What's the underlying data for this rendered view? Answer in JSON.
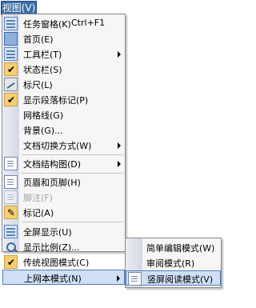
{
  "menubar": {
    "title": "视图(V)"
  },
  "menu": {
    "items": [
      {
        "label": "任务窗格(K)",
        "shortcut": "Ctrl+F1"
      },
      {
        "label": "首页(E)"
      },
      {
        "label": "工具栏(T)"
      },
      {
        "label": "状态栏(S)"
      },
      {
        "label": "标尺(L)"
      },
      {
        "label": "显示段落标记(P)"
      },
      {
        "label": "网格线(G)"
      },
      {
        "label": "背景(G)..."
      },
      {
        "label": "文档切换方式(W)"
      },
      {
        "label": "文档结构图(D)"
      },
      {
        "label": "页眉和页脚(H)"
      },
      {
        "label": "脚注(F)"
      },
      {
        "label": "标记(A)"
      },
      {
        "label": "全屏显示(U)"
      },
      {
        "label": "显示比例(Z)..."
      },
      {
        "label": "传统视图模式(C)"
      },
      {
        "label": "上网本模式(N)"
      }
    ]
  },
  "submenu": {
    "items": [
      {
        "label": "简单编辑模式(W)"
      },
      {
        "label": "审阅模式(R)"
      },
      {
        "label": "竖屏阅读模式(V)"
      }
    ]
  },
  "colors": {
    "accent": "#3a6ea5",
    "highlight": "#cfe0f6",
    "check_bg": "#f7cf73"
  }
}
